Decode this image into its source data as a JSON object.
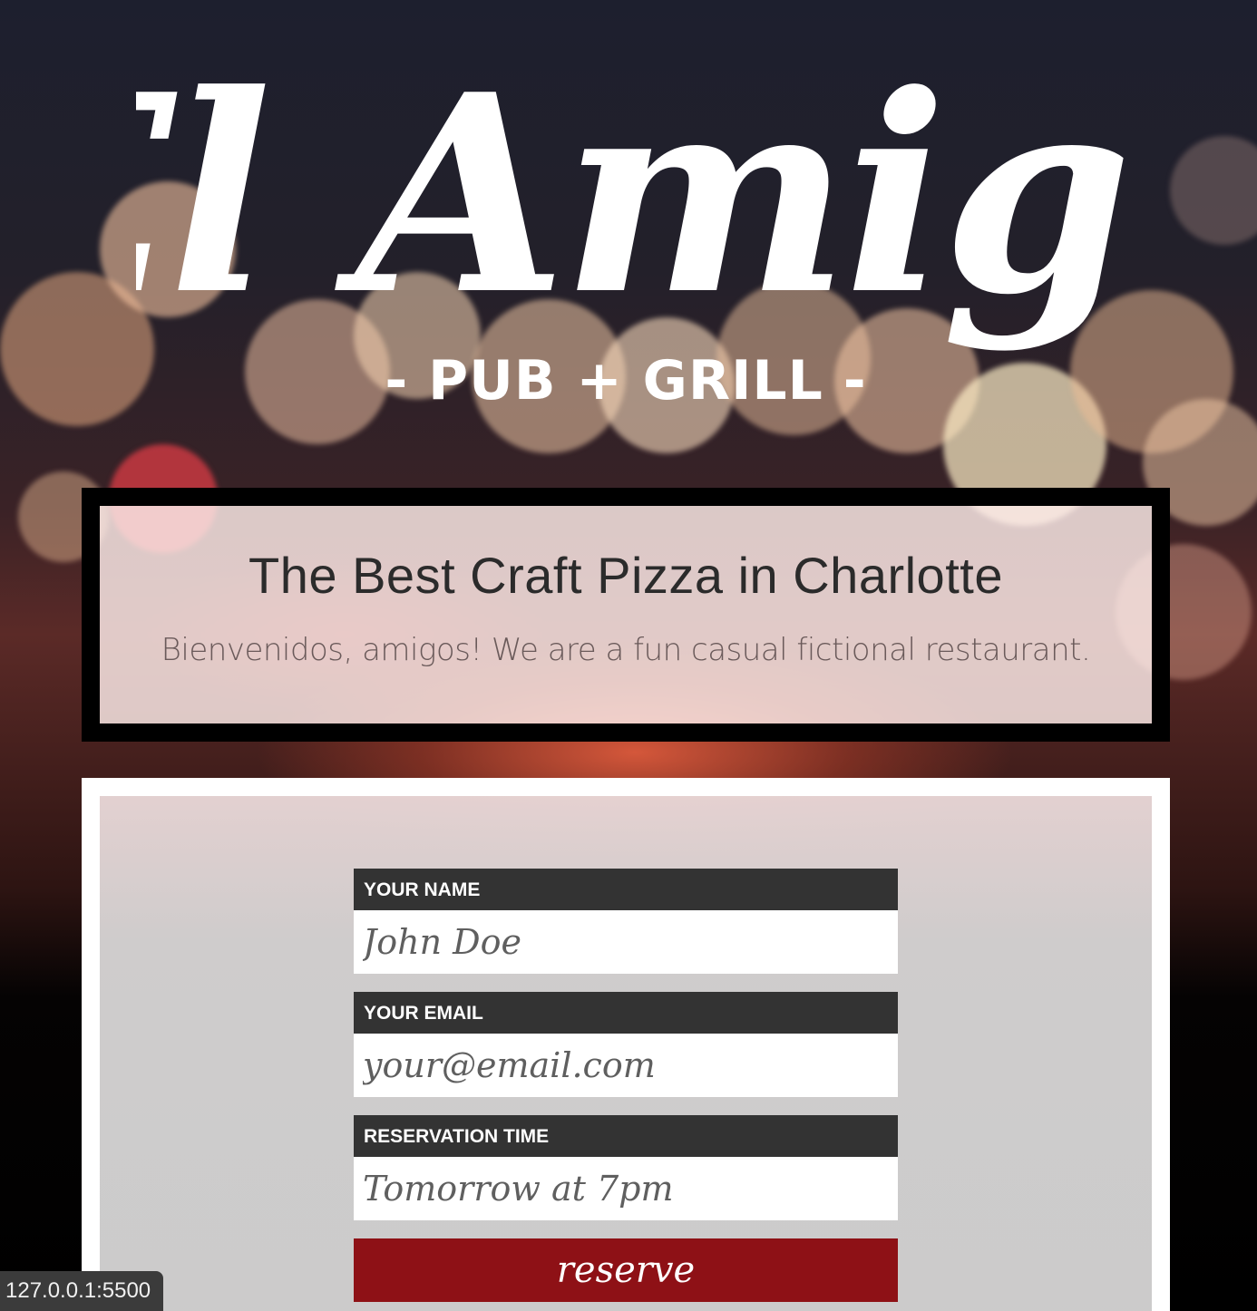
{
  "logo": {
    "main_text": "El Amigo",
    "tagline": "- PUB + GRILL -"
  },
  "hero": {
    "title": "The Best Craft Pizza in Charlotte",
    "subtitle": "Bienvenidos, amigos! We are a fun casual fictional restaurant."
  },
  "form": {
    "name_label": "YOUR NAME",
    "name_placeholder": "John Doe",
    "email_label": "YOUR EMAIL",
    "email_placeholder": "your@email.com",
    "time_label": "RESERVATION TIME",
    "time_placeholder": "Tomorrow at 7pm",
    "submit_label": "reserve"
  },
  "status_bar": {
    "url": "127.0.0.1:5500"
  },
  "colors": {
    "button_bg": "#8e1116",
    "label_bg": "#333333",
    "form_bg": "#cbcbcb"
  }
}
